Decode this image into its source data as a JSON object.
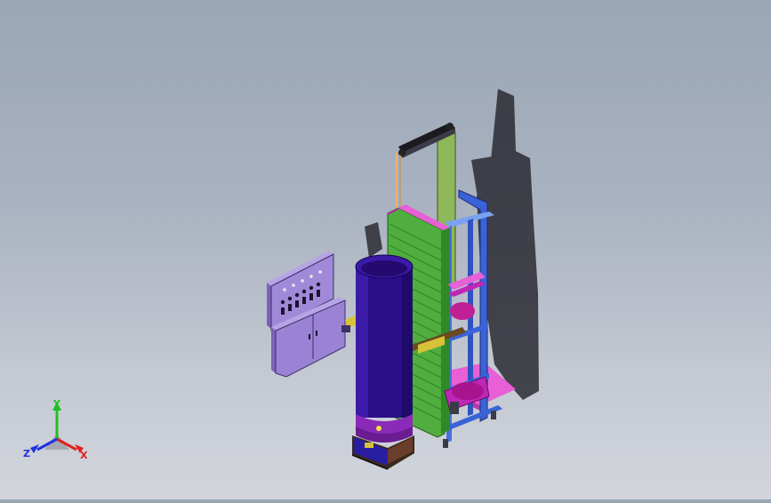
{
  "viewport": {
    "background_top": "#9aa6b6",
    "background_bottom": "#d2d5dc",
    "model_colors": {
      "tank": "#2a0e8a",
      "tank_rim": "#3b1aa8",
      "panel": "#a08ad8",
      "panel_dark": "#7d62b8",
      "green_plate": "#4fae3e",
      "frame_green": "#8fb85a",
      "frame_blue": "#3a63d8",
      "magenta": "#c026b5",
      "pink_base": "#e85fd6",
      "shadow": "#2a2a32"
    }
  },
  "triad": {
    "x_label": "X",
    "y_label": "Y",
    "z_label": "Z",
    "x_color": "#e02020",
    "y_color": "#20c020",
    "z_color": "#2030e0"
  }
}
